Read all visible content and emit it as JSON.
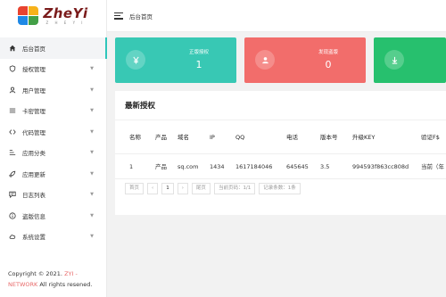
{
  "brand": {
    "name": "ZheYi",
    "sub": "Z H E Y I"
  },
  "sidebar": {
    "items": [
      {
        "label": "后台首页",
        "icon": "home-icon",
        "active": true
      },
      {
        "label": "授权管理",
        "icon": "shield-icon",
        "arrow": "▼"
      },
      {
        "label": "用户管理",
        "icon": "user-icon",
        "arrow": "▼"
      },
      {
        "label": "卡密管理",
        "icon": "list-icon",
        "arrow": "▼"
      },
      {
        "label": "代码管理",
        "icon": "code-icon",
        "arrow": "▼"
      },
      {
        "label": "应用分类",
        "icon": "sort-icon",
        "arrow": "▼"
      },
      {
        "label": "应用更新",
        "icon": "rocket-icon",
        "arrow": "▼"
      },
      {
        "label": "日志列表",
        "icon": "chat-icon",
        "arrow": "▼"
      },
      {
        "label": "盗版信息",
        "icon": "info-icon",
        "arrow": "▼"
      },
      {
        "label": "系统设置",
        "icon": "cloud-icon",
        "arrow": "▼"
      }
    ],
    "footer": {
      "prefix": "Copyright © 2021. ",
      "brand1": "ZYI -",
      "brand2": "NETWORK",
      "suffix": " All rights resened."
    }
  },
  "topbar": {
    "title": "后台首页"
  },
  "cards": [
    {
      "label": "正版授权",
      "value": "1",
      "color": "#38c8b4",
      "icon": "yen-icon"
    },
    {
      "label": "发现盗版",
      "value": "0",
      "color": "#f26d6b",
      "icon": "user-icon"
    },
    {
      "label": "",
      "value": "",
      "color": "#27c06e",
      "icon": "download-icon"
    }
  ],
  "panel": {
    "title": "最新授权",
    "headers": [
      "名称",
      "产品",
      "域名",
      "IP",
      "QQ",
      "电话",
      "版本号",
      "升级KEY",
      "验证F$"
    ],
    "rows": [
      [
        "1",
        "产品",
        "sq.com",
        "1434",
        "1617184046",
        "645645",
        "3.5",
        "994593f863cc808d",
        "当前（年"
      ]
    ],
    "pager": [
      "首页",
      "‹",
      "1",
      "›",
      "尾页",
      "当前页码：1/1",
      "记录条数：1条"
    ]
  }
}
